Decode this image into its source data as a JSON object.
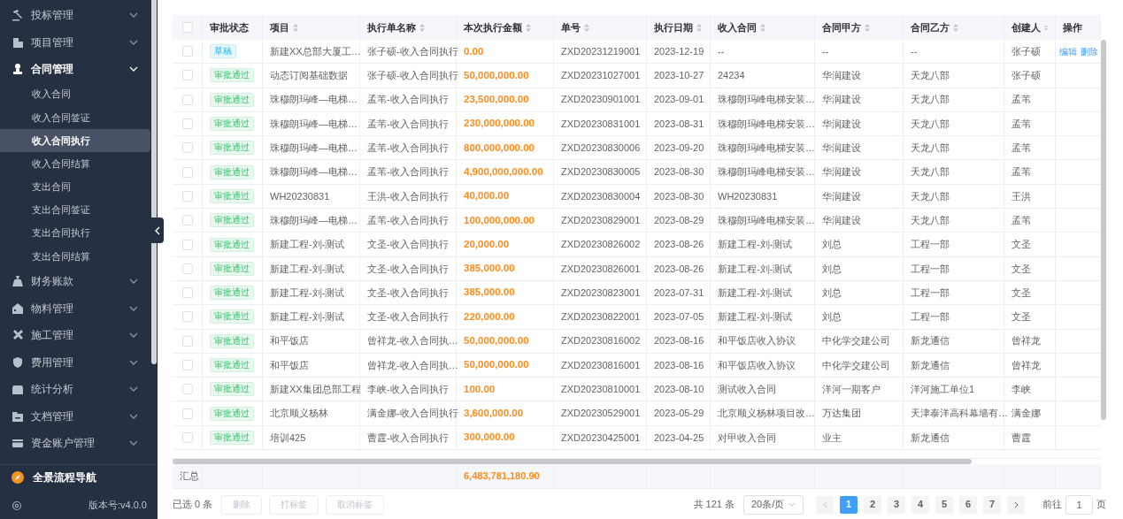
{
  "sidebar": {
    "menus": [
      {
        "label": "投标管理",
        "expanded": false
      },
      {
        "label": "项目管理",
        "expanded": false
      },
      {
        "label": "合同管理",
        "expanded": true,
        "children": [
          {
            "label": "收入合同",
            "selected": false
          },
          {
            "label": "收入合同签证",
            "selected": false
          },
          {
            "label": "收入合同执行",
            "selected": true
          },
          {
            "label": "收入合同结算",
            "selected": false
          },
          {
            "label": "支出合同",
            "selected": false
          },
          {
            "label": "支出合同签证",
            "selected": false
          },
          {
            "label": "支出合同执行",
            "selected": false
          },
          {
            "label": "支出合同结算",
            "selected": false
          }
        ]
      },
      {
        "label": "财务账款",
        "expanded": false
      },
      {
        "label": "物料管理",
        "expanded": false
      },
      {
        "label": "施工管理",
        "expanded": false
      },
      {
        "label": "费用管理",
        "expanded": false
      },
      {
        "label": "统计分析",
        "expanded": false
      },
      {
        "label": "文档管理",
        "expanded": false
      },
      {
        "label": "资金账户管理",
        "expanded": false
      }
    ],
    "flow_nav": "全景流程导航",
    "version": "版本号:v4.0.0"
  },
  "table": {
    "columns": [
      {
        "kind": "checkbox",
        "checked": false
      },
      {
        "kind": "text",
        "label": "审批状态",
        "sortable": false
      },
      {
        "kind": "text",
        "label": "项目",
        "sortable": true
      },
      {
        "kind": "text",
        "label": "执行单名称",
        "sortable": true
      },
      {
        "kind": "text",
        "label": "本次执行金额",
        "sortable": true
      },
      {
        "kind": "text",
        "label": "单号",
        "sortable": true
      },
      {
        "kind": "text",
        "label": "执行日期",
        "sortable": true
      },
      {
        "kind": "text",
        "label": "收入合同",
        "sortable": true
      },
      {
        "kind": "text",
        "label": "合同甲方",
        "sortable": true
      },
      {
        "kind": "text",
        "label": "合同乙方",
        "sortable": true
      },
      {
        "kind": "text",
        "label": "创建人",
        "sortable": true
      },
      {
        "kind": "text",
        "label": "操作",
        "sortable": false
      }
    ],
    "rows": [
      {
        "cells": [
          {
            "checked": false
          },
          {
            "tag": "草稿",
            "kind": "draft"
          },
          "新建XX总部大厦工…",
          "张子硕-收入合同执行",
          "0.00",
          "ZXD20231219001",
          "2023-12-19",
          "--",
          "--",
          "--",
          "张子硕",
          {
            "actions": [
              "编辑",
              "删除"
            ]
          }
        ]
      },
      {
        "cells": [
          {
            "checked": false
          },
          {
            "tag": "审批通过",
            "kind": "approved"
          },
          "动态订阅基础数据",
          "张子硕-收入合同执行",
          "50,000,000.00",
          "ZXD20231027001",
          "2023-10-27",
          "24234",
          "华润建设",
          "天龙八部",
          "张子硕"
        ]
      },
      {
        "cells": [
          {
            "checked": false
          },
          {
            "tag": "审批通过",
            "kind": "approved"
          },
          "珠穆朗玛峰—电梯…",
          "孟苇-收入合同执行",
          "23,500,000.00",
          "ZXD20230901001",
          "2023-09-01",
          "珠穆朗玛峰电梯安装…",
          "华润建设",
          "天龙八部",
          "孟苇"
        ]
      },
      {
        "cells": [
          {
            "checked": false
          },
          {
            "tag": "审批通过",
            "kind": "approved"
          },
          "珠穆朗玛峰—电梯…",
          "孟苇-收入合同执行",
          "230,000,000.00",
          "ZXD20230831001",
          "2023-08-31",
          "珠穆朗玛峰电梯安装…",
          "华润建设",
          "天龙八部",
          "孟苇"
        ]
      },
      {
        "cells": [
          {
            "checked": false
          },
          {
            "tag": "审批通过",
            "kind": "approved"
          },
          "珠穆朗玛峰—电梯…",
          "孟苇-收入合同执行",
          "800,000,000.00",
          "ZXD20230830006",
          "2023-09-20",
          "珠穆朗玛峰电梯安装…",
          "华润建设",
          "天龙八部",
          "孟苇"
        ]
      },
      {
        "cells": [
          {
            "checked": false
          },
          {
            "tag": "审批通过",
            "kind": "approved"
          },
          "珠穆朗玛峰—电梯…",
          "孟苇-收入合同执行",
          "4,900,000,000.00",
          "ZXD20230830005",
          "2023-08-30",
          "珠穆朗玛峰电梯安装…",
          "华润建设",
          "天龙八部",
          "孟苇"
        ]
      },
      {
        "cells": [
          {
            "checked": false
          },
          {
            "tag": "审批通过",
            "kind": "approved"
          },
          "WH20230831",
          "王洪-收入合同执行",
          "40,000.00",
          "ZXD20230830004",
          "2023-08-30",
          "WH20230831",
          "华润建设",
          "天龙八部",
          "王洪"
        ]
      },
      {
        "cells": [
          {
            "checked": false
          },
          {
            "tag": "审批通过",
            "kind": "approved"
          },
          "珠穆朗玛峰—电梯…",
          "孟苇-收入合同执行",
          "100,000,000.00",
          "ZXD20230829001",
          "2023-08-29",
          "珠穆朗玛峰电梯安装…",
          "华润建设",
          "天龙八部",
          "孟苇"
        ]
      },
      {
        "cells": [
          {
            "checked": false
          },
          {
            "tag": "审批通过",
            "kind": "approved"
          },
          "新建工程-刘-测试",
          "文圣-收入合同执行",
          "20,000.00",
          "ZXD20230826002",
          "2023-08-26",
          "新建工程-刘-测试",
          "刘总",
          "工程一部",
          "文圣"
        ]
      },
      {
        "cells": [
          {
            "checked": false
          },
          {
            "tag": "审批通过",
            "kind": "approved"
          },
          "新建工程-刘-测试",
          "文圣-收入合同执行",
          "385,000.00",
          "ZXD20230826001",
          "2023-08-26",
          "新建工程-刘-测试",
          "刘总",
          "工程一部",
          "文圣"
        ]
      },
      {
        "cells": [
          {
            "checked": false
          },
          {
            "tag": "审批通过",
            "kind": "approved"
          },
          "新建工程-刘-测试",
          "文圣-收入合同执行",
          "385,000.00",
          "ZXD20230823001",
          "2023-07-31",
          "新建工程-刘-测试",
          "刘总",
          "工程一部",
          "文圣"
        ]
      },
      {
        "cells": [
          {
            "checked": false
          },
          {
            "tag": "审批通过",
            "kind": "approved"
          },
          "新建工程-刘-测试",
          "文圣-收入合同执行",
          "220,000.00",
          "ZXD20230822001",
          "2023-07-05",
          "新建工程-刘-测试",
          "刘总",
          "工程一部",
          "文圣"
        ]
      },
      {
        "cells": [
          {
            "checked": false
          },
          {
            "tag": "审批通过",
            "kind": "approved"
          },
          "和平饭店",
          "曾祥龙-收入合同执…",
          "50,000,000.00",
          "ZXD20230816002",
          "2023-08-16",
          "和平饭店收入协议",
          "中化学交建公司",
          "新龙通信",
          "曾祥龙"
        ]
      },
      {
        "cells": [
          {
            "checked": false
          },
          {
            "tag": "审批通过",
            "kind": "approved"
          },
          "和平饭店",
          "曾祥龙-收入合同执…",
          "50,000,000.00",
          "ZXD20230816001",
          "2023-08-16",
          "和平饭店收入协议",
          "中化学交建公司",
          "新龙通信",
          "曾祥龙"
        ]
      },
      {
        "cells": [
          {
            "checked": false
          },
          {
            "tag": "审批通过",
            "kind": "approved"
          },
          "新建XX集团总部工程",
          "李峡-收入合同执行",
          "100.00",
          "ZXD20230810001",
          "2023-08-10",
          "测试收入合同",
          "洋河一期客户",
          "洋河施工单位1",
          "李峡"
        ]
      },
      {
        "cells": [
          {
            "checked": false
          },
          {
            "tag": "审批通过",
            "kind": "approved"
          },
          "北京顺义杨林",
          "满金娜-收入合同执行",
          "3,600,000.00",
          "ZXD20230529001",
          "2023-05-29",
          "北京顺义杨林项目改…",
          "万达集团",
          "天津泰洋高科幕墙有…",
          "满金娜"
        ]
      },
      {
        "cells": [
          {
            "checked": false
          },
          {
            "tag": "审批通过",
            "kind": "approved"
          },
          "培训425",
          "曹霆-收入合同执行",
          "300,000.00",
          "ZXD20230425001",
          "2023-04-25",
          "对甲收入合同",
          "业主",
          "新龙通信",
          "曹霆"
        ]
      }
    ],
    "summary": {
      "label": "汇总",
      "amount": "6,483,781,180.90"
    }
  },
  "footer": {
    "selected_count": "已选 0 条",
    "buttons": [
      {
        "label": "删除",
        "disabled": true
      },
      {
        "label": "打标签",
        "disabled": true
      },
      {
        "label": "取消标签",
        "disabled": true
      }
    ],
    "total": "共 121 条",
    "page_size": "20条/页",
    "pages": [
      {
        "label": "1",
        "selected": true
      },
      {
        "label": "2",
        "selected": false
      },
      {
        "label": "3",
        "selected": false
      },
      {
        "label": "4",
        "selected": false
      },
      {
        "label": "5",
        "selected": false
      },
      {
        "label": "6",
        "selected": false
      },
      {
        "label": "7",
        "selected": false
      }
    ],
    "goto_label": "前往",
    "goto_value": "1",
    "page_suffix": "页"
  }
}
